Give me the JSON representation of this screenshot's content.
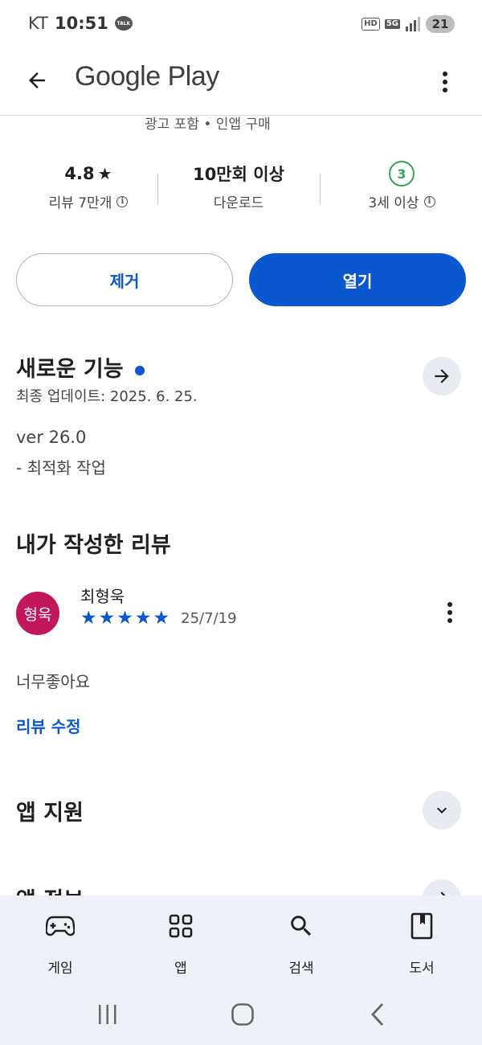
{
  "status_bar": {
    "carrier": "KT",
    "time": "10:51",
    "talk_badge": "TALK",
    "hd_label": "HD",
    "network_label": "5G",
    "battery_level": "21"
  },
  "app_bar": {
    "title": "Google Play"
  },
  "partial_text": "광고 포함 • 인앱 구매",
  "stats": {
    "rating_value": "4.8",
    "rating_star": "★",
    "rating_label": "리뷰 7만개",
    "downloads_value": "10만회 이상",
    "downloads_label": "다운로드",
    "age_value": "3",
    "age_label": "3세 이상",
    "info_glyph": "i"
  },
  "actions": {
    "remove_label": "제거",
    "open_label": "열기"
  },
  "whats_new": {
    "title": "새로운 기능",
    "last_updated": "최종 업데이트: 2025. 6. 25.",
    "version": "ver 26.0",
    "note": "- 최적화 작업"
  },
  "my_review": {
    "title": "내가 작성한 리뷰",
    "avatar_text": "형욱",
    "reviewer_name": "최형욱",
    "stars": 5,
    "star_glyph": "★",
    "date": "25/7/19",
    "text": "너무좋아요",
    "edit_label": "리뷰 수정"
  },
  "app_support": {
    "title": "앱 지원"
  },
  "app_info_partial": "앱 정보",
  "bottom_nav": {
    "items": [
      {
        "label": "게임",
        "icon": "gamepad-icon"
      },
      {
        "label": "앱",
        "icon": "apps-grid-icon"
      },
      {
        "label": "검색",
        "icon": "search-icon"
      },
      {
        "label": "도서",
        "icon": "book-icon"
      }
    ]
  },
  "colors": {
    "accent": "#0b57d0",
    "age_badge": "#34a853",
    "avatar_bg": "#c2185b",
    "nav_bg": "#eef1f7"
  }
}
